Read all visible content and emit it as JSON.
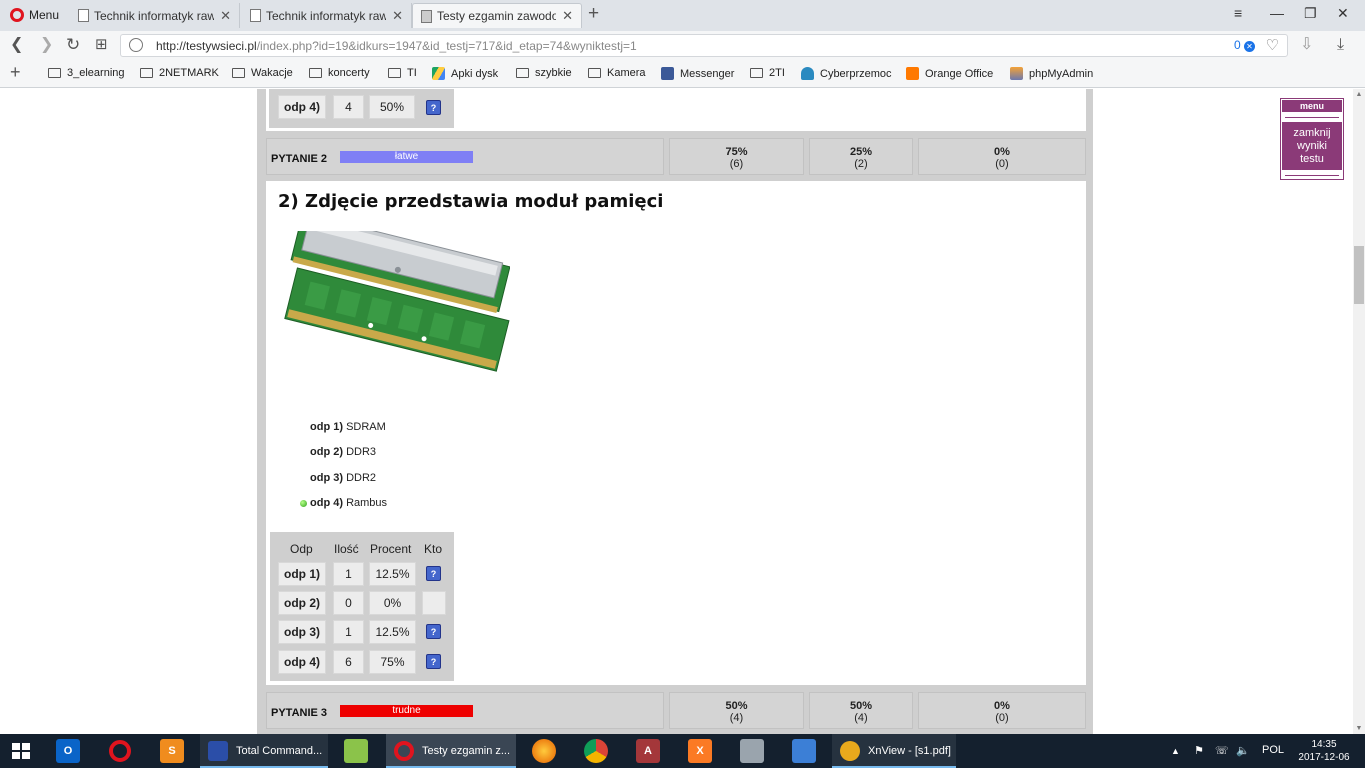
{
  "browser": {
    "menu_label": "Menu",
    "tabs": [
      {
        "title": "Technik informatyk rawa-l",
        "active": false
      },
      {
        "title": "Technik informatyk rawa-l",
        "active": false
      },
      {
        "title": "Testy ezgamin zawodowy",
        "active": true
      }
    ],
    "url_host": "http://testywsieci.pl",
    "url_path": "/index.php?id=19&idkurs=1947&id_testj=717&id_etap=74&wyniktestj=1",
    "blocked_count": "0",
    "bookmarks": [
      {
        "label": "3_elearning",
        "icon": "folder-icon"
      },
      {
        "label": "2NETMARK",
        "icon": "folder-icon"
      },
      {
        "label": "Wakacje",
        "icon": "folder-icon"
      },
      {
        "label": "koncerty",
        "icon": "folder-icon"
      },
      {
        "label": "TI",
        "icon": "folder-icon"
      },
      {
        "label": "Apki dysk",
        "icon": "drive-icon"
      },
      {
        "label": "szybkie",
        "icon": "folder-icon"
      },
      {
        "label": "Kamera",
        "icon": "folder-icon"
      },
      {
        "label": "Messenger",
        "icon": "facebook-icon"
      },
      {
        "label": "2TI",
        "icon": "folder-icon"
      },
      {
        "label": "Cyberprzemoc",
        "icon": "cyber-icon"
      },
      {
        "label": "Orange Office",
        "icon": "orange-icon"
      },
      {
        "label": "phpMyAdmin",
        "icon": "phpmyadmin-icon"
      }
    ]
  },
  "side_menu": {
    "head": "menu",
    "close_line1": "zamknij",
    "close_line2": "wyniki",
    "close_line3": "testu"
  },
  "prev_stats_row": {
    "odp": "odp 4)",
    "ilosc": "4",
    "procent": "50%"
  },
  "q2": {
    "label": "PYTANIE 2",
    "difficulty": "łatwe",
    "difficulty_color": "#7f7ff5",
    "stats": [
      {
        "percent": "75%",
        "count": "(6)"
      },
      {
        "percent": "25%",
        "count": "(2)"
      },
      {
        "percent": "0%",
        "count": "(0)"
      }
    ],
    "title": "2) Zdjęcie przedstawia moduł pamięci",
    "answers": [
      {
        "num": "odp 1)",
        "text": "SDRAM",
        "correct": false
      },
      {
        "num": "odp 2)",
        "text": "DDR3",
        "correct": false
      },
      {
        "num": "odp 3)",
        "text": "DDR2",
        "correct": false
      },
      {
        "num": "odp 4)",
        "text": "Rambus",
        "correct": true
      }
    ],
    "table": {
      "headers": [
        "Odp",
        "Ilość",
        "Procent",
        "Kto"
      ],
      "rows": [
        {
          "odp": "odp 1)",
          "ilosc": "1",
          "procent": "12.5%",
          "kto": "?"
        },
        {
          "odp": "odp 2)",
          "ilosc": "0",
          "procent": "0%",
          "kto": ""
        },
        {
          "odp": "odp 3)",
          "ilosc": "1",
          "procent": "12.5%",
          "kto": "?"
        },
        {
          "odp": "odp 4)",
          "ilosc": "6",
          "procent": "75%",
          "kto": "?"
        }
      ]
    }
  },
  "q3": {
    "label": "PYTANIE 3",
    "difficulty": "trudne",
    "difficulty_color": "#ee0000",
    "stats": [
      {
        "percent": "50%",
        "count": "(4)"
      },
      {
        "percent": "50%",
        "count": "(4)"
      },
      {
        "percent": "0%",
        "count": "(0)"
      }
    ]
  },
  "taskbar": {
    "items": [
      {
        "label": "Total Command...",
        "icon": "total-commander-icon"
      },
      {
        "label": "Testy ezgamin z...",
        "icon": "opera-icon"
      },
      {
        "label": "XnView - [s1.pdf]",
        "icon": "xnview-icon"
      }
    ],
    "language": "POL",
    "time": "14:35",
    "date": "2017-12-06"
  }
}
